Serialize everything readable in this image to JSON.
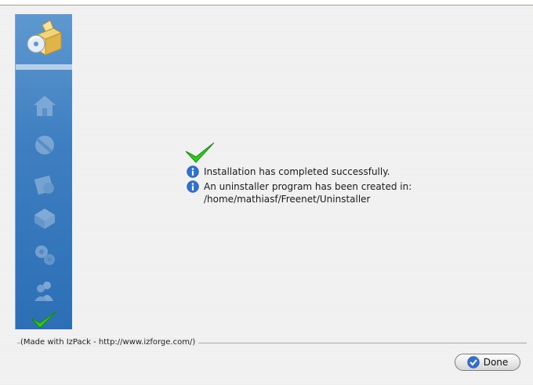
{
  "window": {
    "title": ""
  },
  "sidebar": {
    "logo_icon": "installer-box-icon",
    "steps": [
      {
        "name": "hello-step-icon",
        "state": "done"
      },
      {
        "name": "info-step-icon",
        "state": "done"
      },
      {
        "name": "licence-step-icon",
        "state": "done"
      },
      {
        "name": "target-step-icon",
        "state": "done"
      },
      {
        "name": "packs-step-icon",
        "state": "done"
      },
      {
        "name": "install-step-icon",
        "state": "done"
      },
      {
        "name": "finish-check-icon",
        "state": "current"
      }
    ]
  },
  "main": {
    "status_icon": "green-check-icon",
    "messages": [
      {
        "icon": "info-icon",
        "text": "Installation has completed successfully."
      },
      {
        "icon": "info-icon",
        "text": "An uninstaller program has been created in:"
      }
    ],
    "path": "/home/mathiasf/Freenet/Uninstaller"
  },
  "footer": {
    "credit": "(Made with IzPack - http://www.izforge.com/)",
    "done_label": "Done",
    "done_icon": "done-check-icon"
  },
  "colors": {
    "sidebar": "#3f7fc1",
    "check_green": "#2ecc1a",
    "info_blue": "#2f6fd0"
  }
}
